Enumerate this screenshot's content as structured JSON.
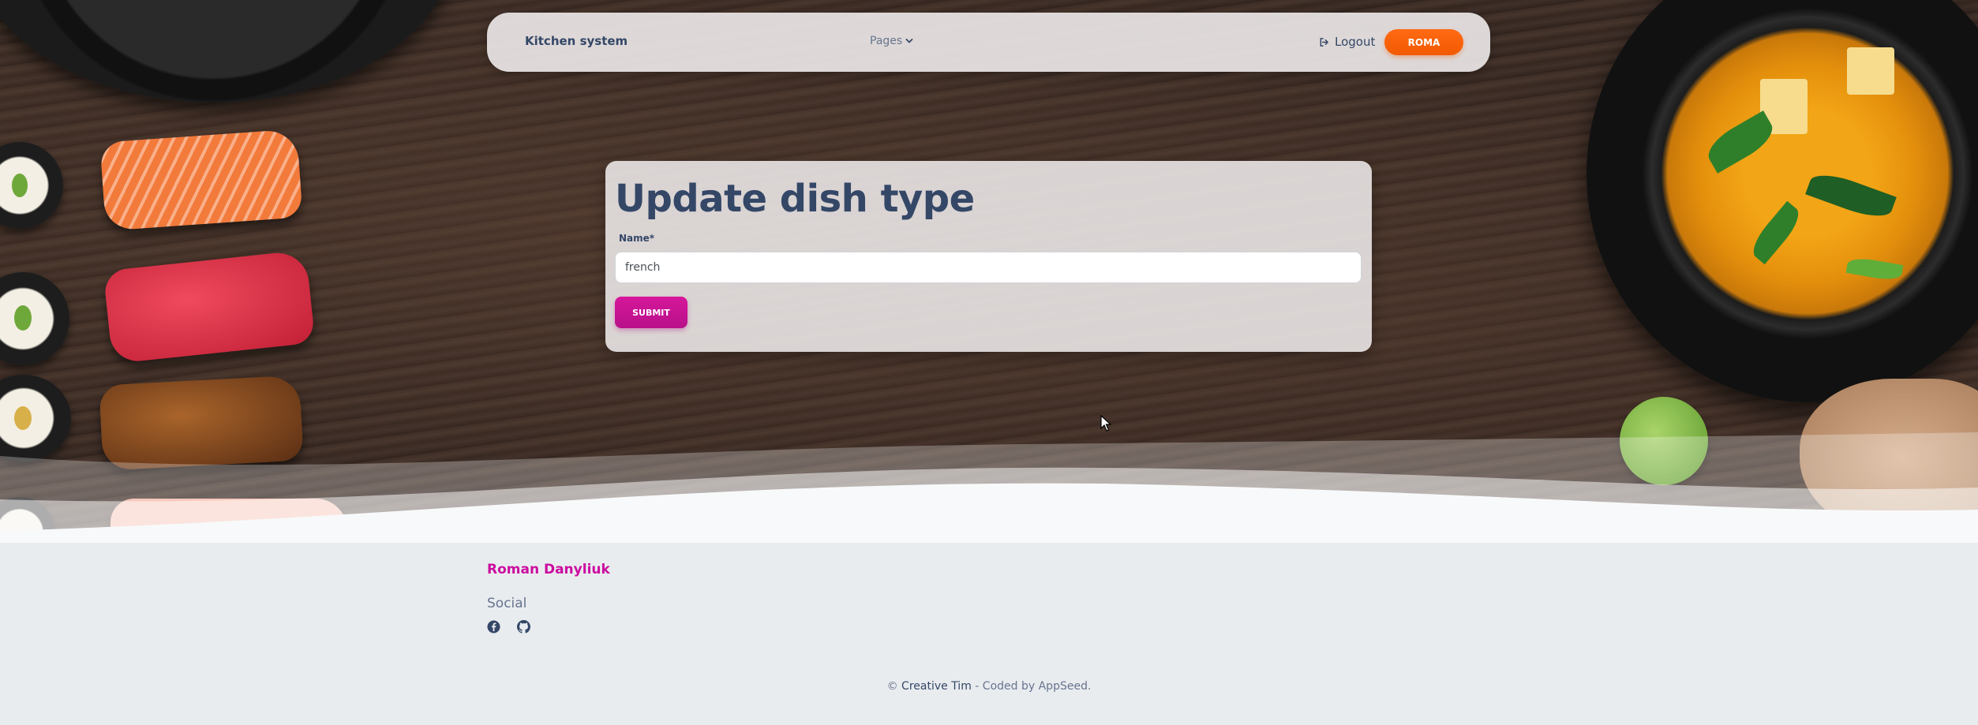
{
  "navbar": {
    "brand": "Kitchen system",
    "pages_label": "Pages",
    "logout_label": "Logout",
    "user_button": "ROMA"
  },
  "form": {
    "title": "Update dish type",
    "name_label": "Name*",
    "name_value": "french",
    "submit_label": "SUBMIT"
  },
  "footer": {
    "author": "Roman Danyliuk",
    "social_heading": "Social",
    "social_icons": [
      "facebook-icon",
      "github-icon"
    ],
    "copyright_prefix": "©",
    "copyright_link": "Creative Tim",
    "copyright_suffix": "- Coded by AppSeed."
  },
  "colors": {
    "accent_pink": "#cb0c9f",
    "accent_orange": "#f25a00",
    "text_dark": "#344767"
  }
}
